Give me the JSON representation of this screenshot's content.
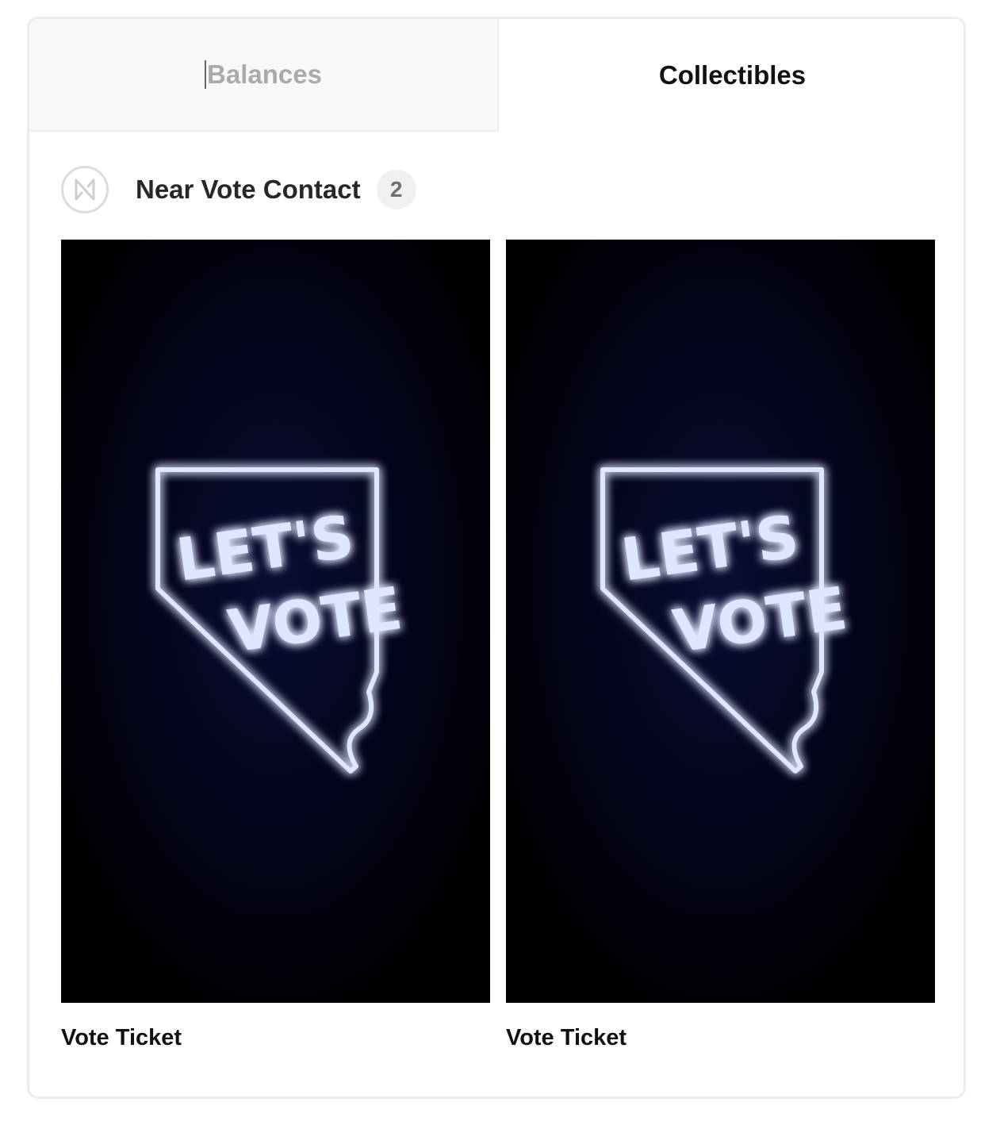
{
  "tabs": {
    "balances_label": "Balances",
    "collectibles_label": "Collectibles",
    "active": "Collectibles"
  },
  "collection": {
    "name": "Near Vote Contact",
    "count": "2",
    "logo_icon": "near-logo-icon"
  },
  "nfts": [
    {
      "title": "Vote Ticket",
      "image_text_line1": "LET'S",
      "image_text_line2": "VOTE"
    },
    {
      "title": "Vote Ticket",
      "image_text_line1": "LET'S",
      "image_text_line2": "VOTE"
    }
  ],
  "colors": {
    "neon": "#dfe6ff",
    "neon_glow": "#3a4dff",
    "inactive_tab_bg": "#f8f8f8",
    "inactive_tab_text": "#a9a9ae"
  }
}
